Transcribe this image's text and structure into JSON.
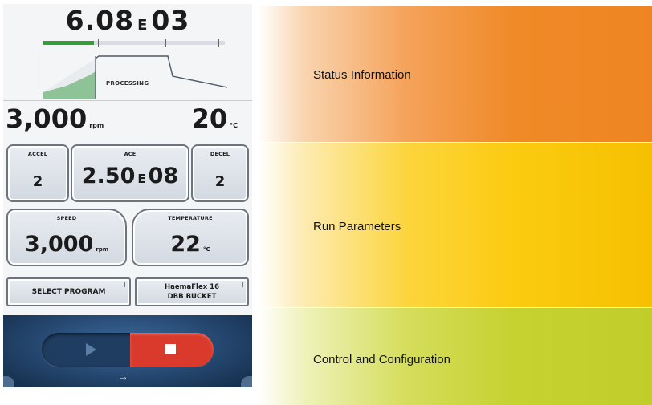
{
  "status": {
    "ace_mantissa": "6.08",
    "ace_e": "E",
    "ace_exponent": "03",
    "progress_fraction": 0.28,
    "phase_label": "PROCESSING",
    "speed_value": "3,000",
    "speed_unit": "rpm",
    "temp_value": "20",
    "temp_unit": "°C"
  },
  "params": {
    "accel": {
      "label": "ACCEL",
      "value": "2"
    },
    "ace": {
      "label": "ACE",
      "mantissa": "2.50",
      "e": "E",
      "exponent": "08"
    },
    "decel": {
      "label": "DECEL",
      "value": "2"
    },
    "speed": {
      "label": "SPEED",
      "value": "3,000",
      "unit": "rpm"
    },
    "temperature": {
      "label": "TEMPERATURE",
      "value": "22",
      "unit": "°C"
    },
    "select_program": "SELECT PROGRAM",
    "rotor_line1": "HaemaFlex 16",
    "rotor_line2": "DBB BUCKET"
  },
  "controls": {
    "play_icon": "play-icon",
    "stop_icon": "stop-icon",
    "key_icon": "key-icon",
    "stop_color": "#d93a2b"
  },
  "bands": {
    "status": "Status Information",
    "run": "Run Parameters",
    "control": "Control and Configuration",
    "colors": {
      "status": "#ee8522",
      "run": "#f6c000",
      "control": "#c1cd2b"
    }
  }
}
